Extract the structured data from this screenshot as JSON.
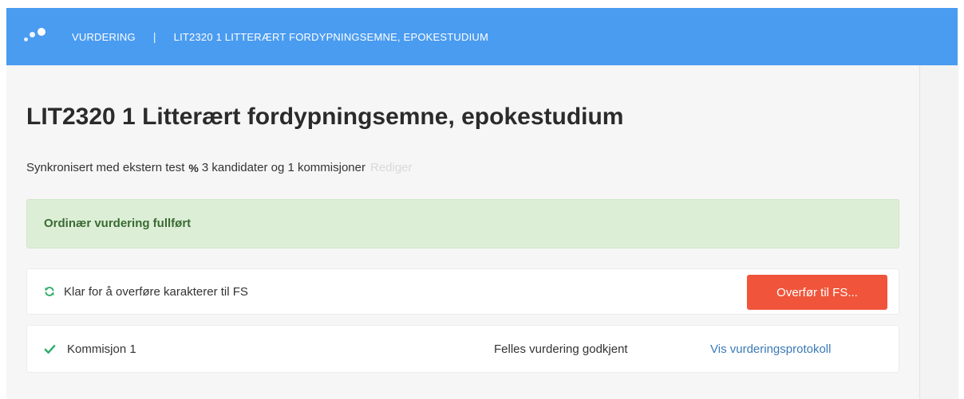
{
  "header": {
    "breadcrumb_section": "VURDERING",
    "breadcrumb_separator": "|",
    "breadcrumb_course": "LIT2320 1 LITTERÆRT FORDYPNINGSEMNE, EPOKESTUDIUM"
  },
  "page": {
    "title": "LIT2320 1 Litterært fordypningsemne, epokestudium",
    "sync_text": "Synkronisert med ekstern test",
    "sync_details": "3 kandidater og 1 kommisjoner",
    "edit_link": "Rediger"
  },
  "alert": {
    "text": "Ordinær vurdering fullført"
  },
  "transfer": {
    "status_text": "Klar for å overføre karakterer til FS",
    "button_label": "Overfør til FS..."
  },
  "commission": {
    "name": "Kommisjon 1",
    "status": "Felles vurdering godkjent",
    "link_label": "Vis vurderingsprotokoll"
  },
  "icons": {
    "logo": "dots-logo-icon",
    "sync": "link-icon",
    "transfer": "refresh-icon",
    "commission": "check-icon"
  },
  "colors": {
    "header_bg": "#4a9cf1",
    "alert_bg": "#dcefd6",
    "alert_text": "#3b6a34",
    "button_bg": "#f0553b",
    "check_green": "#2fae6b",
    "link_blue": "#3a7ab8"
  }
}
